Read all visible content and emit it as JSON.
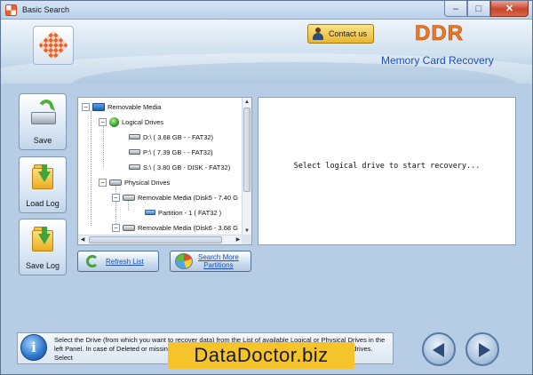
{
  "window": {
    "title": "Basic Search",
    "controls": {
      "minimize": "–",
      "maximize": "□",
      "close": "✕"
    }
  },
  "header": {
    "contact_label": "Contact us",
    "brand": "DDR",
    "product": "Memory Card Recovery"
  },
  "toolbar": {
    "save_label": "Save",
    "load_log_label": "Load Log",
    "save_log_label": "Save Log"
  },
  "tree": {
    "root": "Removable Media",
    "logical_group": "Logical Drives",
    "logical_drives": [
      "D:\\ ( 3.68 GB - - FAT32)",
      "P:\\ ( 7.39 GB - - FAT32)",
      "S:\\ ( 3.80 GB - DISK - FAT32)"
    ],
    "physical_group": "Physical Drives",
    "physical_drives": [
      {
        "label": "Removable Media (Disk5 - 7.40 G",
        "partition": "Partition - 1 ( FAT32 )"
      },
      {
        "label": "Removable Media (Disk6 - 3.68 G"
      }
    ]
  },
  "message": "Select logical drive to start recovery...",
  "actions": {
    "refresh_label": "Refresh List",
    "search_label_1": "Search More",
    "search_label_2": "Partitions"
  },
  "info": {
    "icon_glyph": "i",
    "text": "Select the Drive (from which you want to recover data) from the List of available Logical or Physical Drives in the left Panel. In case of Deleted or missing partitions, click on 'Search More Partitions' button to find lost drives. Select"
  },
  "watermark": "DataDoctor.biz",
  "icons": {
    "app": "ddr-logo-icon",
    "contact": "person-icon",
    "save": "disk-save-icon",
    "load": "folder-load-icon",
    "save_log": "folder-save-icon",
    "refresh": "refresh-icon",
    "search": "pie-chart-icon",
    "info": "info-icon",
    "back": "arrow-left-icon",
    "next": "arrow-right-icon"
  },
  "colors": {
    "brand": "#ef7a22",
    "product": "#1e4fb4",
    "link": "#1e4fb4",
    "watermark_bg": "#f5c32a"
  }
}
